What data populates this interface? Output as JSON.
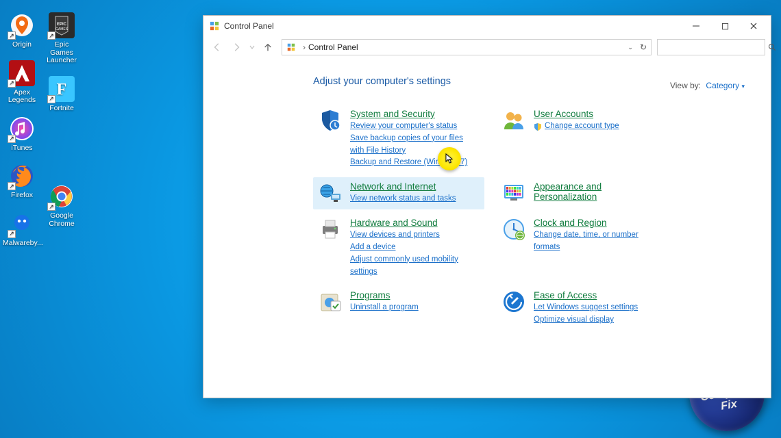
{
  "desktop": {
    "icons_col1": [
      {
        "label": "Origin",
        "bg": "#ffffff",
        "glyph": "origin"
      },
      {
        "label": "Apex Legends",
        "bg": "#b30f13",
        "glyph": "apex"
      },
      {
        "label": "iTunes",
        "bg": "#ffffff",
        "glyph": "itunes"
      },
      {
        "label": "Firefox",
        "bg": "#ffffff",
        "glyph": "firefox"
      },
      {
        "label": "Malwareby...",
        "bg": "#ffffff",
        "glyph": "mbam"
      }
    ],
    "icons_col2": [
      {
        "label": "Epic Games Launcher",
        "bg": "#2b2b2b",
        "glyph": "epic"
      },
      {
        "label": "Fortnite",
        "bg": "#39c6ff",
        "glyph": "fortnite"
      },
      {
        "label": "",
        "bg": "transparent",
        "glyph": ""
      },
      {
        "label": "Google Chrome",
        "bg": "#ffffff",
        "glyph": "chrome"
      }
    ]
  },
  "badge": {
    "text": "Nick's\nComputer\nFix"
  },
  "window": {
    "title": "Control Panel",
    "address": "Control Panel",
    "search_placeholder": "",
    "heading": "Adjust your computer's settings",
    "viewby_label": "View by:",
    "viewby_value": "Category"
  },
  "categories": {
    "left": [
      {
        "title": "System and Security",
        "links": [
          "Review your computer's status",
          "Save backup copies of your files with File History",
          "Backup and Restore (Windows 7)"
        ],
        "icon": "shield",
        "hover": false
      },
      {
        "title": "Network and Internet",
        "links": [
          "View network status and tasks"
        ],
        "icon": "network",
        "hover": true
      },
      {
        "title": "Hardware and Sound",
        "links": [
          "View devices and printers",
          "Add a device",
          "Adjust commonly used mobility settings"
        ],
        "icon": "printer",
        "hover": false
      },
      {
        "title": "Programs",
        "links": [
          "Uninstall a program"
        ],
        "icon": "programs",
        "hover": false
      }
    ],
    "right": [
      {
        "title": "User Accounts",
        "links": [
          "Change account type"
        ],
        "icon": "users",
        "hover": false,
        "link_icon": "uac-shield"
      },
      {
        "title": "Appearance and Personalization",
        "links": [],
        "icon": "appearance",
        "hover": false
      },
      {
        "title": "Clock and Region",
        "links": [
          "Change date, time, or number formats"
        ],
        "icon": "clock",
        "hover": false
      },
      {
        "title": "Ease of Access",
        "links": [
          "Let Windows suggest settings",
          "Optimize visual display"
        ],
        "icon": "ease",
        "hover": false
      }
    ]
  }
}
